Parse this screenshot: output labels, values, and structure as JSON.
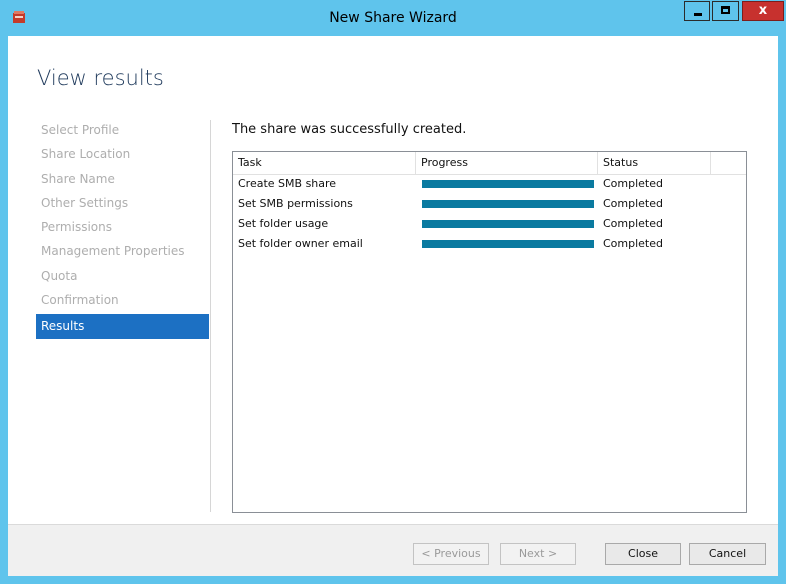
{
  "window": {
    "title": "New Share Wizard",
    "close_glyph": "x"
  },
  "page": {
    "title": "View results",
    "message": "The share was successfully created."
  },
  "sidebar": {
    "items": [
      {
        "label": "Select Profile"
      },
      {
        "label": "Share Location"
      },
      {
        "label": "Share Name"
      },
      {
        "label": "Other Settings"
      },
      {
        "label": "Permissions"
      },
      {
        "label": "Management Properties"
      },
      {
        "label": "Quota"
      },
      {
        "label": "Confirmation"
      },
      {
        "label": "Results",
        "active": true
      }
    ]
  },
  "tasks": {
    "columns": {
      "task": "Task",
      "progress": "Progress",
      "status": "Status"
    },
    "rows": [
      {
        "task": "Create SMB share",
        "progress": 1.0,
        "status": "Completed"
      },
      {
        "task": "Set SMB permissions",
        "progress": 1.0,
        "status": "Completed"
      },
      {
        "task": "Set folder usage",
        "progress": 1.0,
        "status": "Completed"
      },
      {
        "task": "Set folder owner email",
        "progress": 1.0,
        "status": "Completed"
      }
    ]
  },
  "buttons": {
    "previous": "< Previous",
    "next": "Next >",
    "close": "Close",
    "cancel": "Cancel"
  },
  "colors": {
    "titlebar": "#5fc4ec",
    "accent": "#1c70c3",
    "progress_fill": "#0a7aa0",
    "close_button": "#c7312e"
  }
}
